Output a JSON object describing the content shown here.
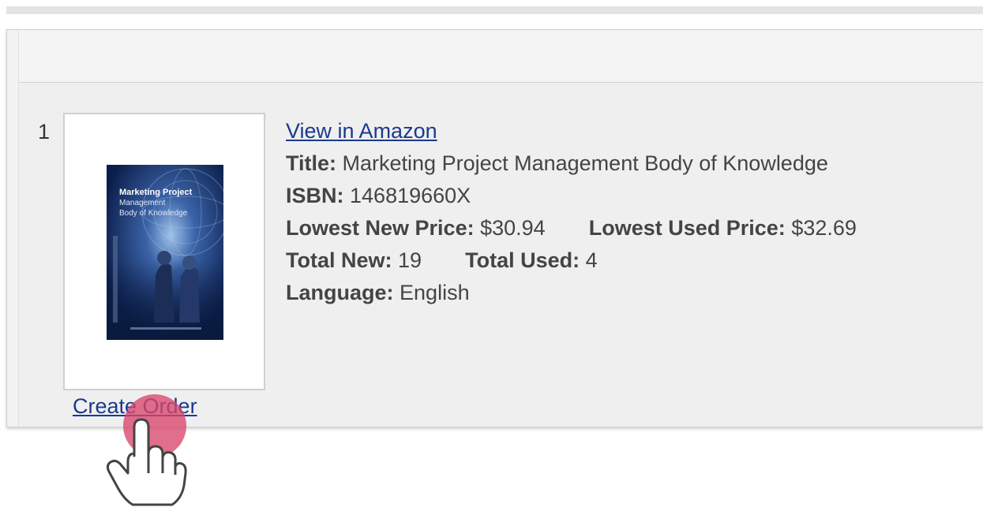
{
  "result": {
    "index": "1",
    "view_link": "View in Amazon",
    "title_label": "Title:",
    "title_value": "Marketing Project Management Body of Knowledge",
    "isbn_label": "ISBN:",
    "isbn_value": "146819660X",
    "lowest_new_label": "Lowest New Price:",
    "lowest_new_value": "$30.94",
    "lowest_used_label": "Lowest Used Price:",
    "lowest_used_value": "$32.69",
    "total_new_label": "Total New:",
    "total_new_value": "19",
    "total_used_label": "Total Used:",
    "total_used_value": "4",
    "language_label": "Language:",
    "language_value": "English",
    "create_order": "Create Order",
    "cover": {
      "title_line1": "Marketing Project",
      "title_line2": "Management",
      "title_line3": "Body of Knowledge"
    }
  },
  "colors": {
    "link": "#1a3a8c",
    "cursor_highlight": "#d9456a",
    "cover_dark": "#0b1e4a"
  },
  "cursor": {
    "icon": "hand-pointer-icon"
  }
}
